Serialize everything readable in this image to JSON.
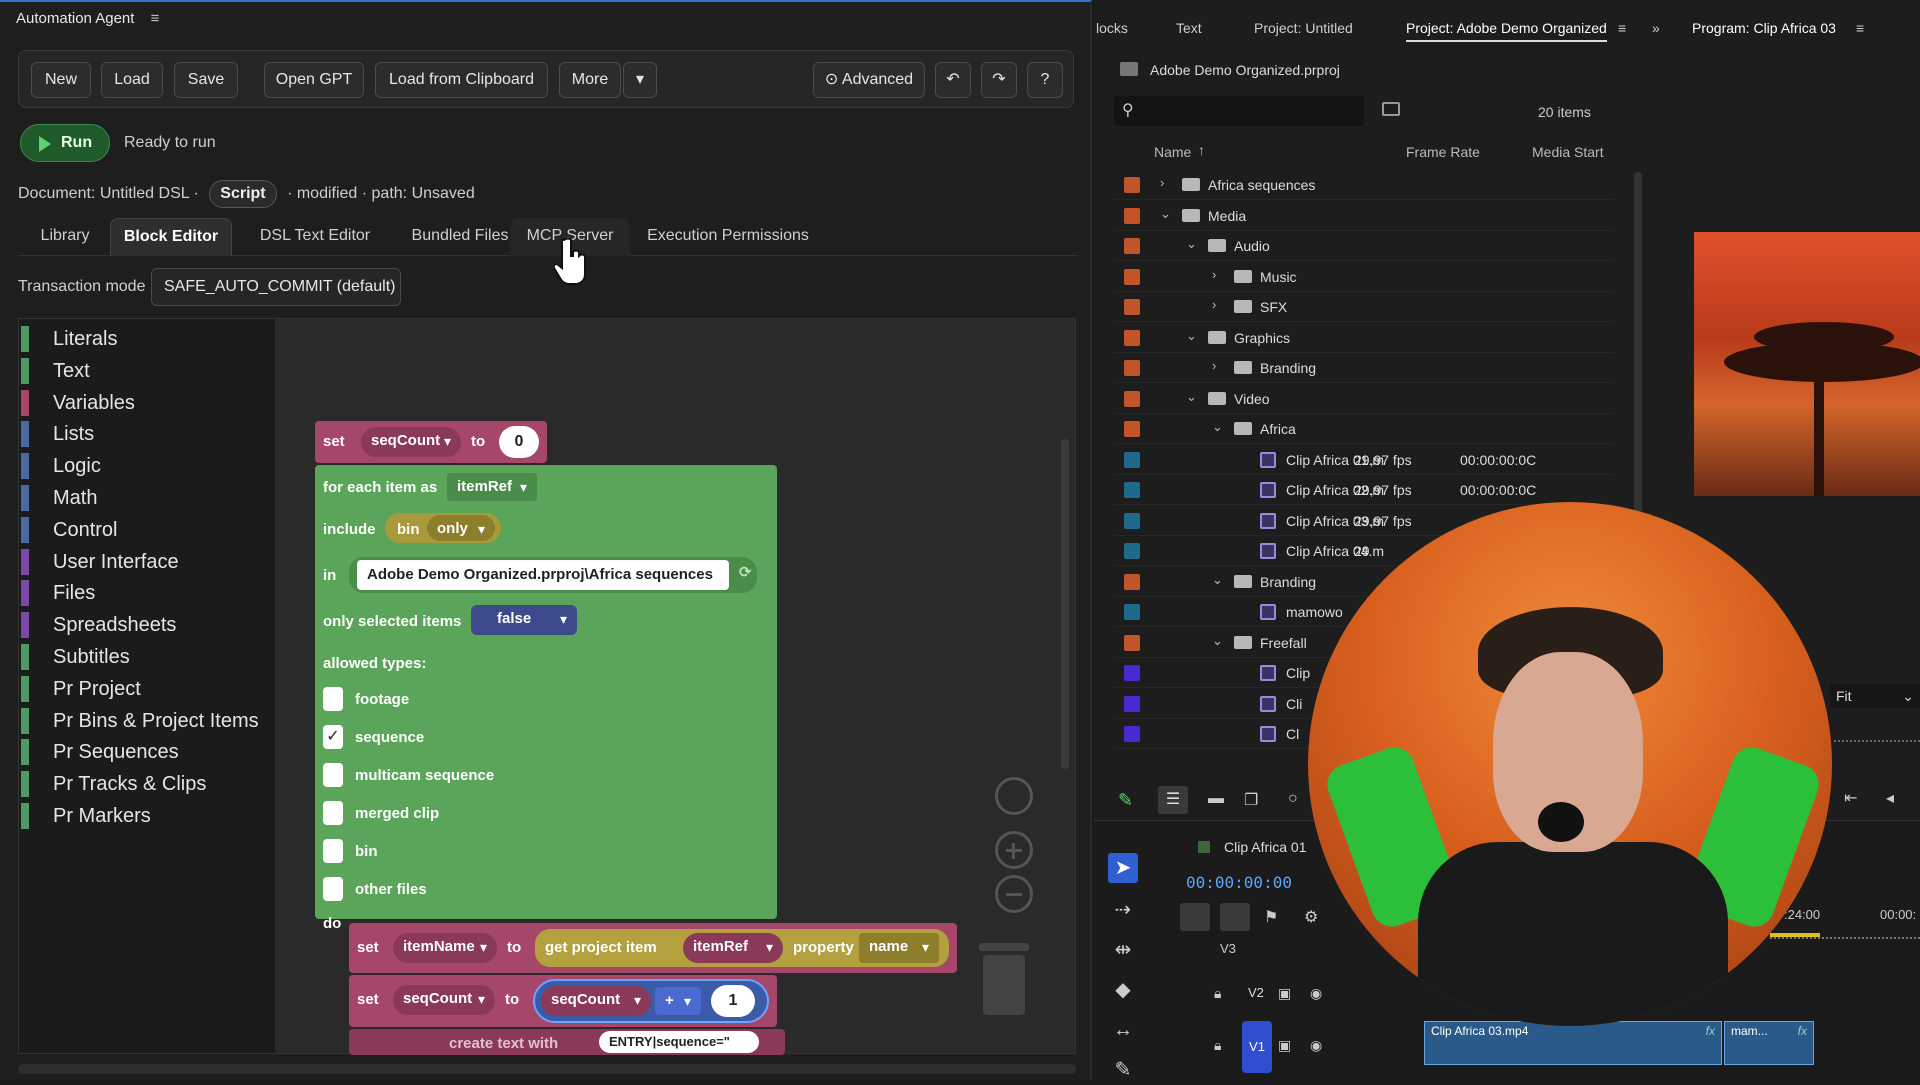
{
  "left_panel": {
    "title": "Automation Agent",
    "title_menu": "≡",
    "toolbar": {
      "new": "New",
      "load": "Load",
      "save": "Save",
      "open_gpt": "Open GPT",
      "load_clipboard": "Load from Clipboard",
      "more": "More",
      "more_caret": "▾",
      "advanced": "⊙ Advanced",
      "undo": "↶",
      "redo": "↷",
      "help": "?"
    },
    "run_label": "Run",
    "status": "Ready to run",
    "document": {
      "prefix": "Document: Untitled DSL ·",
      "chip": "Script",
      "suffix": "· modified · path:  Unsaved"
    },
    "tabs": [
      "Library",
      "Block Editor",
      "DSL Text Editor",
      "Bundled Files",
      "MCP Server",
      "Execution Permissions"
    ],
    "transaction_label": "Transaction mode",
    "transaction_value": "SAFE_AUTO_COMMIT (default)",
    "categories": [
      {
        "label": "Literals",
        "color": "#4f9a63"
      },
      {
        "label": "Text",
        "color": "#4f9a63"
      },
      {
        "label": "Variables",
        "color": "#a6466a"
      },
      {
        "label": "Lists",
        "color": "#4a6aa6"
      },
      {
        "label": "Logic",
        "color": "#4a6aa6"
      },
      {
        "label": "Math",
        "color": "#4a6aa6"
      },
      {
        "label": "Control",
        "color": "#4a6aa6"
      },
      {
        "label": "User Interface",
        "color": "#7a4aa6"
      },
      {
        "label": "Files",
        "color": "#7a4aa6"
      },
      {
        "label": "Spreadsheets",
        "color": "#7a4aa6"
      },
      {
        "label": "Subtitles",
        "color": "#4f9a63"
      },
      {
        "label": "Pr Project",
        "color": "#4f9a63"
      },
      {
        "label": "Pr Bins & Project Items",
        "color": "#4f9a63"
      },
      {
        "label": "Pr Sequences",
        "color": "#4f9a63"
      },
      {
        "label": "Pr Tracks & Clips",
        "color": "#4f9a63"
      },
      {
        "label": "Pr Markers",
        "color": "#4f9a63"
      }
    ],
    "blocks": {
      "set1": {
        "kw": "set",
        "var": "seqCount",
        "to": "to",
        "value": "0"
      },
      "foreach": {
        "kw": "for each item as",
        "var": "itemRef"
      },
      "include": {
        "kw": "include",
        "a": "bin",
        "b": "only"
      },
      "in": {
        "kw": "in",
        "path": "Adobe Demo Organized.prproj\\Africa sequences"
      },
      "only_sel": {
        "kw": "only selected items",
        "value": "false"
      },
      "allowed": "allowed types:",
      "types": [
        {
          "label": "footage",
          "checked": false
        },
        {
          "label": "sequence",
          "checked": true
        },
        {
          "label": "multicam sequence",
          "checked": false
        },
        {
          "label": "merged clip",
          "checked": false
        },
        {
          "label": "bin",
          "checked": false
        },
        {
          "label": "other files",
          "checked": false
        }
      ],
      "check_mark": "✓",
      "do": "do",
      "set2": {
        "kw": "set",
        "var": "itemName",
        "to": "to",
        "fn": "get project item",
        "ref": "itemRef",
        "prop": "property",
        "prop_val": "name"
      },
      "set3": {
        "kw": "set",
        "var": "seqCount",
        "to": "to",
        "ref": "seqCount",
        "op": "+",
        "num": "1"
      },
      "create_text": {
        "label": "create text with",
        "val": "ENTRY|sequence=\""
      }
    }
  },
  "right_panel": {
    "tabs": [
      "locks",
      "Text",
      "Project: Untitled",
      "Project: Adobe Demo Organized",
      "≡",
      "»",
      "Program: Clip Africa 03",
      "≡"
    ],
    "project_file": "Adobe Demo Organized.prproj",
    "item_count": "20 items",
    "columns": {
      "name": "Name",
      "sort": "↑",
      "frame_rate": "Frame Rate",
      "media_start": "Media Start"
    },
    "rows": [
      {
        "label": "Africa sequences",
        "indent": 0,
        "kind": "folder",
        "chev": "›",
        "color": "#c4552a",
        "fps": "",
        "start": ""
      },
      {
        "label": "Media",
        "indent": 0,
        "kind": "folder",
        "chev": "⌄",
        "color": "#c4552a",
        "fps": "",
        "start": ""
      },
      {
        "label": "Audio",
        "indent": 1,
        "kind": "folder",
        "chev": "⌄",
        "color": "#c4552a",
        "fps": "",
        "start": ""
      },
      {
        "label": "Music",
        "indent": 2,
        "kind": "folder",
        "chev": "›",
        "color": "#c4552a",
        "fps": "",
        "start": ""
      },
      {
        "label": "SFX",
        "indent": 2,
        "kind": "folder",
        "chev": "›",
        "color": "#c4552a",
        "fps": "",
        "start": ""
      },
      {
        "label": "Graphics",
        "indent": 1,
        "kind": "folder",
        "chev": "⌄",
        "color": "#c4552a",
        "fps": "",
        "start": ""
      },
      {
        "label": "Branding",
        "indent": 2,
        "kind": "folder",
        "chev": "›",
        "color": "#c4552a",
        "fps": "",
        "start": ""
      },
      {
        "label": "Video",
        "indent": 1,
        "kind": "folder",
        "chev": "⌄",
        "color": "#c4552a",
        "fps": "",
        "start": ""
      },
      {
        "label": "Africa",
        "indent": 2,
        "kind": "folder",
        "chev": "⌄",
        "color": "#c4552a",
        "fps": "",
        "start": ""
      },
      {
        "label": "Clip Africa 01.m",
        "indent": 3,
        "kind": "clip",
        "chev": "",
        "color": "#1f6a8a",
        "fps": "29,97 fps",
        "start": "00:00:00:0C"
      },
      {
        "label": "Clip Africa 02.m",
        "indent": 3,
        "kind": "clip",
        "chev": "",
        "color": "#1f6a8a",
        "fps": "29,97 fps",
        "start": "00:00:00:0C"
      },
      {
        "label": "Clip Africa 03.m",
        "indent": 3,
        "kind": "clip",
        "chev": "",
        "color": "#1f6a8a",
        "fps": "29,97 fps",
        "start": ""
      },
      {
        "label": "Clip Africa 04.m",
        "indent": 3,
        "kind": "clip",
        "chev": "",
        "color": "#1f6a8a",
        "fps": "29",
        "start": ""
      },
      {
        "label": "Branding",
        "indent": 2,
        "kind": "folder",
        "chev": "⌄",
        "color": "#c4552a",
        "fps": "",
        "start": ""
      },
      {
        "label": "mamowo",
        "indent": 3,
        "kind": "clip",
        "chev": "",
        "color": "#1f6a8a",
        "fps": "",
        "start": ""
      },
      {
        "label": "Freefall",
        "indent": 2,
        "kind": "folder",
        "chev": "⌄",
        "color": "#c4552a",
        "fps": "",
        "start": ""
      },
      {
        "label": "Clip",
        "indent": 3,
        "kind": "clip",
        "chev": "",
        "color": "#4a2ad0",
        "fps": "",
        "start": ""
      },
      {
        "label": "Cli",
        "indent": 3,
        "kind": "clip",
        "chev": "",
        "color": "#4a2ad0",
        "fps": "",
        "start": ""
      },
      {
        "label": "Cl",
        "indent": 3,
        "kind": "clip",
        "chev": "",
        "color": "#4a2ad0",
        "fps": "",
        "start": ""
      }
    ],
    "fit_label": "Fit",
    "sequence_name": "Clip Africa 01",
    "timecode": "00:00:00:00",
    "ruler_a": "04",
    "ruler_b": ":24:00",
    "ruler_c": "00:00:",
    "tracks": {
      "v3": "V3",
      "v2": "V2",
      "v1": "V1"
    },
    "clips": {
      "c1": "Clip Africa 03.mp4",
      "c2": "mam...",
      "fx": "fx"
    }
  }
}
